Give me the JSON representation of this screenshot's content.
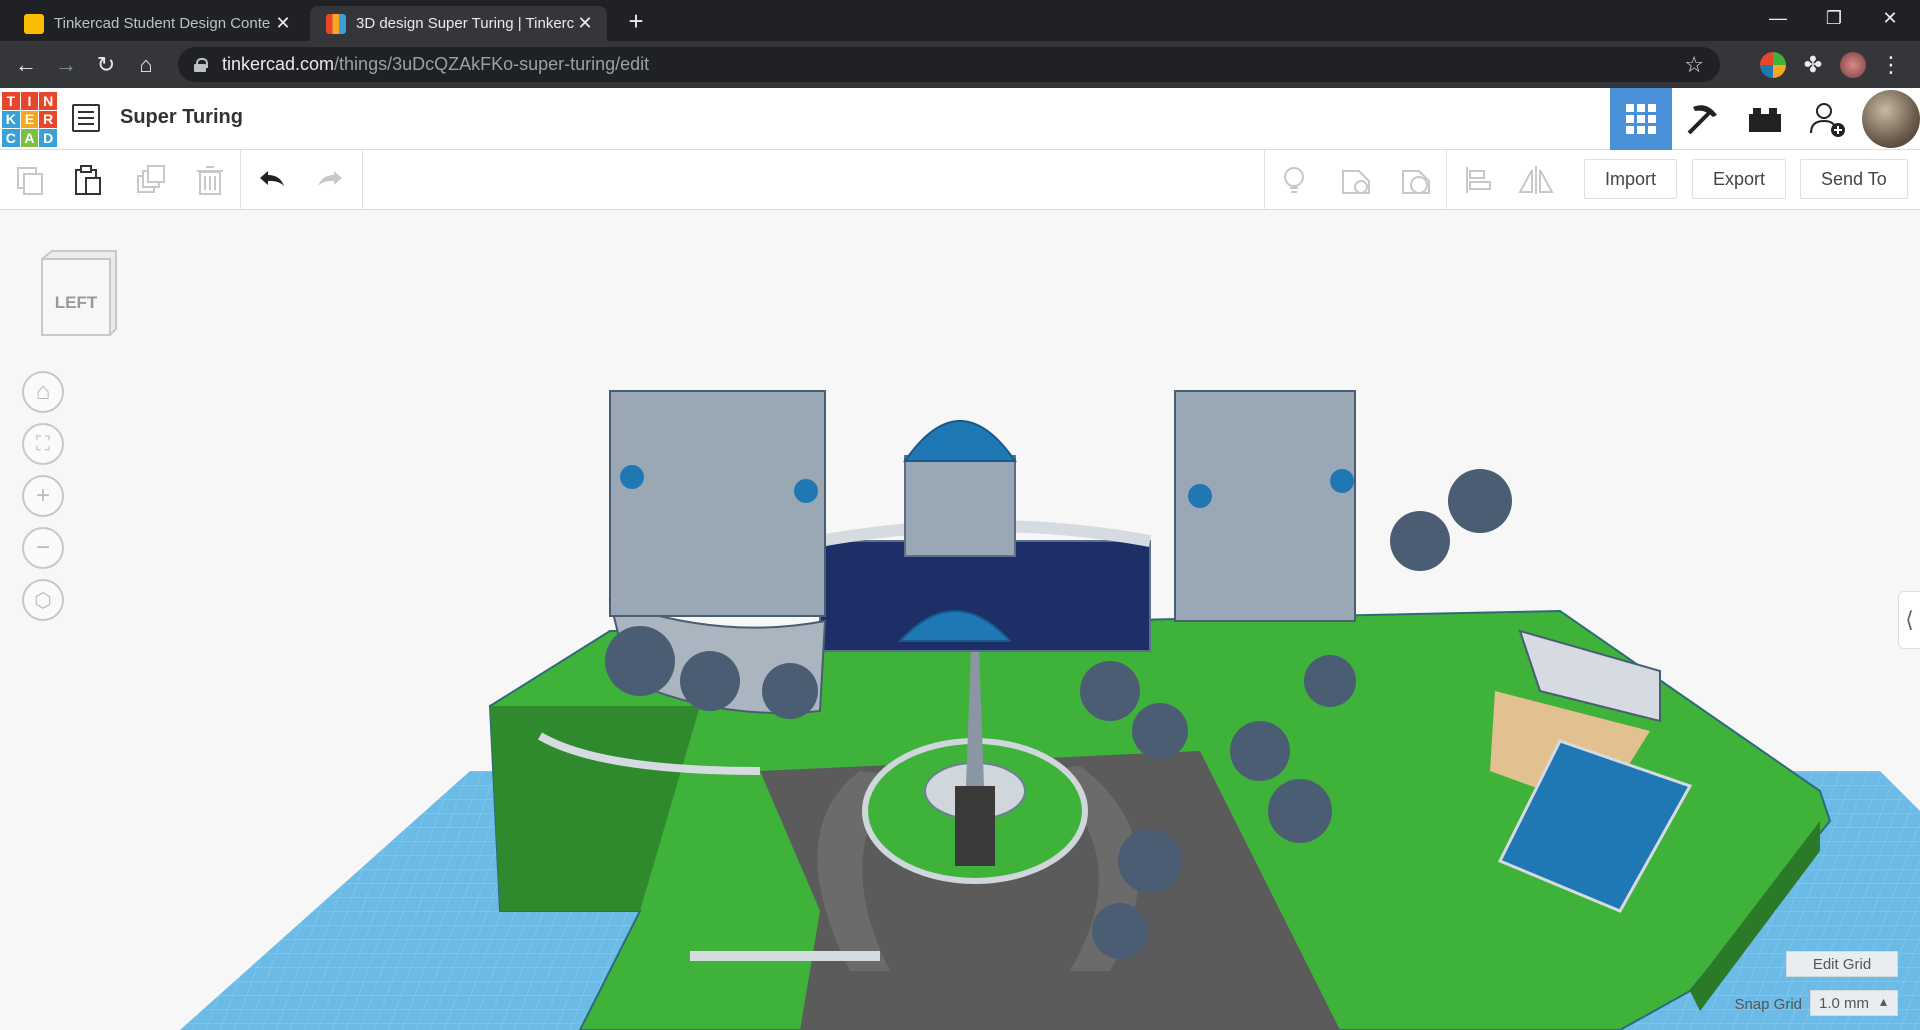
{
  "browser": {
    "tabs": [
      {
        "title": "Tinkercad Student Design Conte",
        "active": false
      },
      {
        "title": "3D design Super Turing | Tinkerc",
        "active": true
      }
    ],
    "url_host": "tinkercad.com",
    "url_path": "/things/3uDcQZAkFKo-super-turing/edit"
  },
  "header": {
    "logo_letters": [
      "T",
      "I",
      "N",
      "K",
      "E",
      "R",
      "C",
      "A",
      "D"
    ],
    "logo_colors": [
      "#e8462c",
      "#e8462c",
      "#e8462c",
      "#3aa1d8",
      "#f5a623",
      "#e8462c",
      "#3aa1d8",
      "#7ac143",
      "#3aa1d8"
    ],
    "design_title": "Super Turing"
  },
  "toolbar": {
    "import_label": "Import",
    "export_label": "Export",
    "send_to_label": "Send To"
  },
  "viewcube": {
    "face_label": "LEFT"
  },
  "grid": {
    "edit_grid_label": "Edit Grid",
    "snap_grid_label": "Snap Grid",
    "snap_value": "1.0 mm"
  },
  "colors": {
    "accent": "#4a90d9",
    "grass": "#3fb23a",
    "workplane": "#5fb0df",
    "building": "#5a6f8a",
    "dome": "#1f78b4"
  }
}
